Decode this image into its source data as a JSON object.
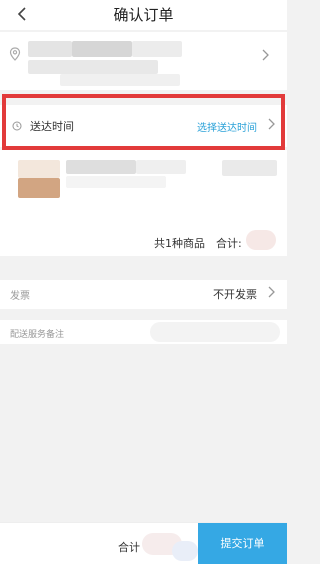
{
  "header": {
    "title": "确认订单",
    "back_icon": "chevron-left-icon"
  },
  "address": {
    "icon": "location-pin-icon",
    "chevron_icon": "chevron-right-icon"
  },
  "delivery_time": {
    "label": "送达时间",
    "action": "选择送达时间",
    "icon": "clock-icon",
    "chevron_icon": "chevron-right-icon",
    "accent_color": "#2aa1d8",
    "highlight_color": "#e23a3a"
  },
  "order_item": {
    "count_text": "共1种商品",
    "subtotal_label": "合计:"
  },
  "invoice": {
    "label": "发票",
    "value": "不开发票",
    "chevron_icon": "chevron-right-icon"
  },
  "remarks": {
    "label": "配送服务备注"
  },
  "footer": {
    "total_label": "合计",
    "submit_label": "提交订单",
    "submit_color": "#35a8e4"
  }
}
